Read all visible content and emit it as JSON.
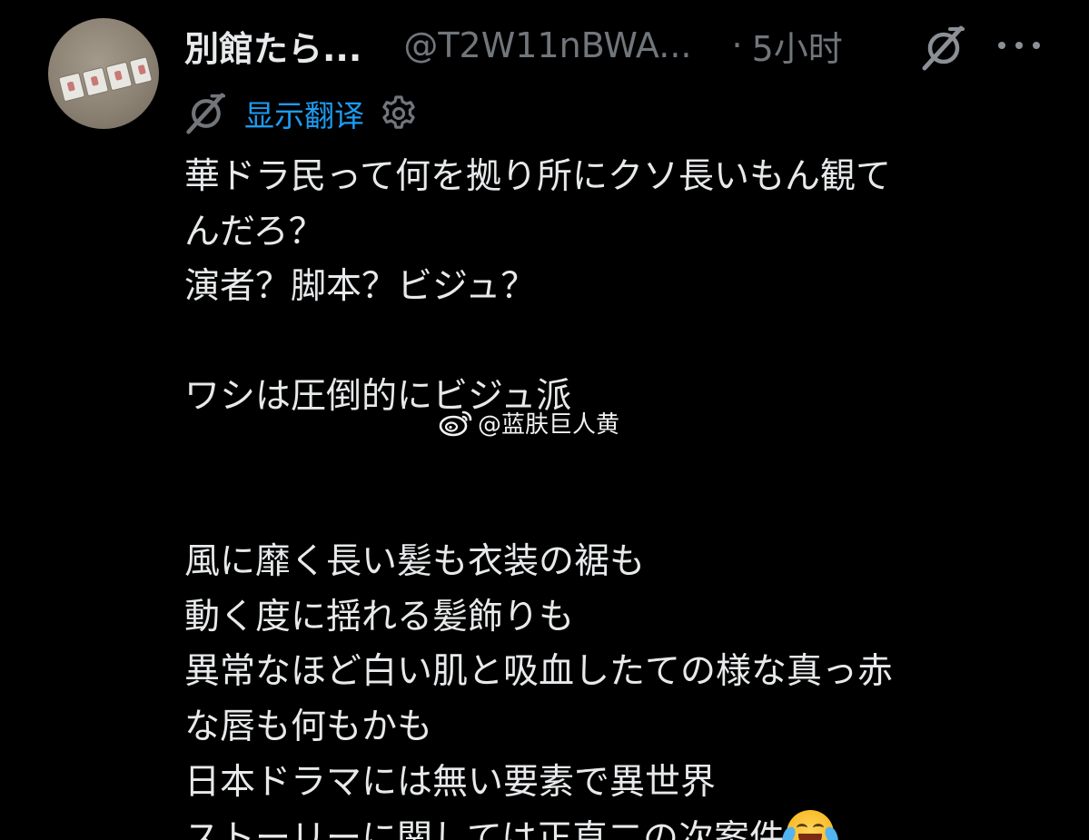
{
  "header": {
    "display_name": "別館たら...",
    "handle": "@T2W11nBWA...",
    "separator": "·",
    "time": "5小时"
  },
  "translate": {
    "label": "显示翻译"
  },
  "body": {
    "lines": [
      "華ドラ民って何を拠り所にクソ長いもん観て",
      "んだろ？",
      "演者？脚本？ビジュ？",
      "",
      "ワシは圧倒的にビジュ派",
      "",
      "",
      "風に靡く長い髪も衣装の裾も",
      "動く度に揺れる髪飾りも",
      "異常なほど白い肌と吸血したての様な真っ赤",
      "な唇も何もかも",
      "日本ドラマには無い要素で異世界",
      "ストーリーに関しては正直二の次案件"
    ],
    "end_emoji": "face-with-tears-of-joy"
  },
  "watermark": {
    "text": "@蓝肤巨人黄"
  },
  "icons": {
    "grok": "grok-icon",
    "more": "more-icon",
    "gear": "gear-icon",
    "weibo": "weibo-logo"
  },
  "colors": {
    "background": "#000000",
    "text": "#e7e9ea",
    "secondary": "#71767b",
    "link": "#1d9bf0"
  }
}
